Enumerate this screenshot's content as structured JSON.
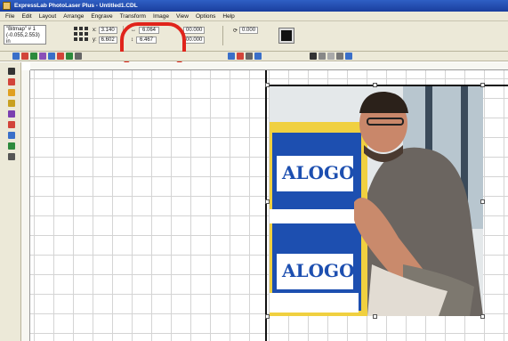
{
  "window": {
    "title": "ExpressLab PhotoLaser Plus - Untitled1.CDL"
  },
  "menu": [
    "File",
    "Edit",
    "Layout",
    "Arrange",
    "Engrave",
    "Transform",
    "Image",
    "View",
    "Options",
    "Help"
  ],
  "properties": {
    "object_type": "\"Bitmap\" # 1",
    "object_pos": "(-0.055,2.553)",
    "object_sub": "in",
    "x_label": "x:",
    "x_value": "3.140",
    "y_label": "y:",
    "y_value": "6.602",
    "width_value": "6.064",
    "height_value": "6.467",
    "scale_x": "00.000",
    "scale_y": "00.000",
    "rotation": "0.000"
  },
  "colors": {
    "highlight": "#e0241b",
    "title_bar": "#2f5fc4",
    "chrome": "#ece9d8"
  }
}
